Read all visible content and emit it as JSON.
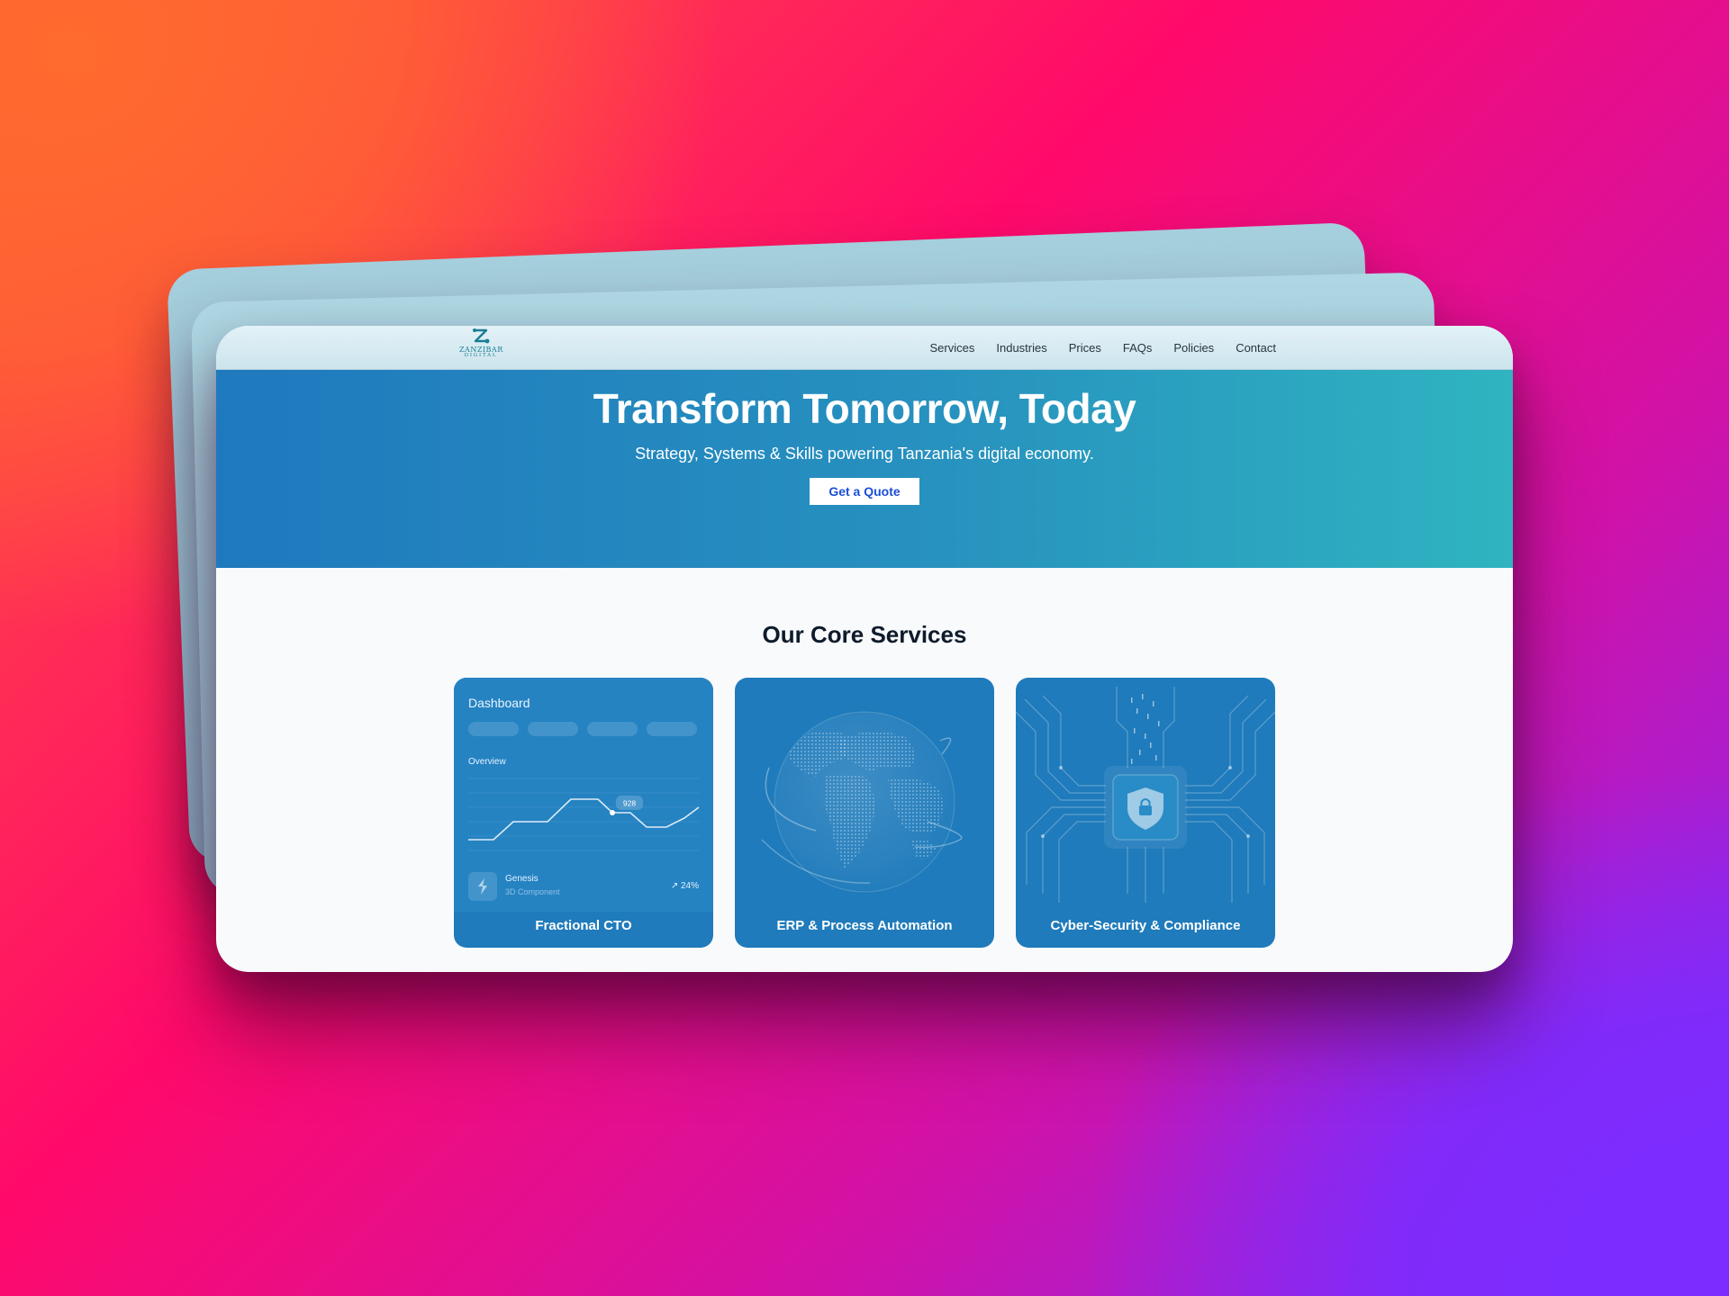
{
  "brand": {
    "name": "ZANZIBAR",
    "tagline": "DIGITAL"
  },
  "nav": {
    "items": [
      {
        "label": "Services"
      },
      {
        "label": "Industries"
      },
      {
        "label": "Prices"
      },
      {
        "label": "FAQs"
      },
      {
        "label": "Policies"
      },
      {
        "label": "Contact"
      }
    ]
  },
  "hero": {
    "title": "Transform Tomorrow, Today",
    "subtitle": "Strategy, Systems & Skills powering Tanzania's digital economy.",
    "cta_label": "Get a Quote"
  },
  "services": {
    "heading": "Our Core Services",
    "cards": [
      {
        "title": "Fractional CTO",
        "art": "dashboard-illustration",
        "dashboard": {
          "title": "Dashboard",
          "section_label": "Overview",
          "tooltip_value": "928",
          "item_name": "Genesis",
          "item_sub": "3D Component",
          "trend": "↗ 24%"
        }
      },
      {
        "title": "ERP & Process Automation",
        "art": "globe-illustration"
      },
      {
        "title": "Cyber-Security & Compliance",
        "art": "shield-lock-circuit-illustration"
      }
    ]
  },
  "colors": {
    "hero_start": "#1f79be",
    "hero_end": "#2fb4c0",
    "card_bg": "#1f7bbb",
    "cta_text": "#1d4ed8",
    "heading_text": "#0f1b2b"
  }
}
